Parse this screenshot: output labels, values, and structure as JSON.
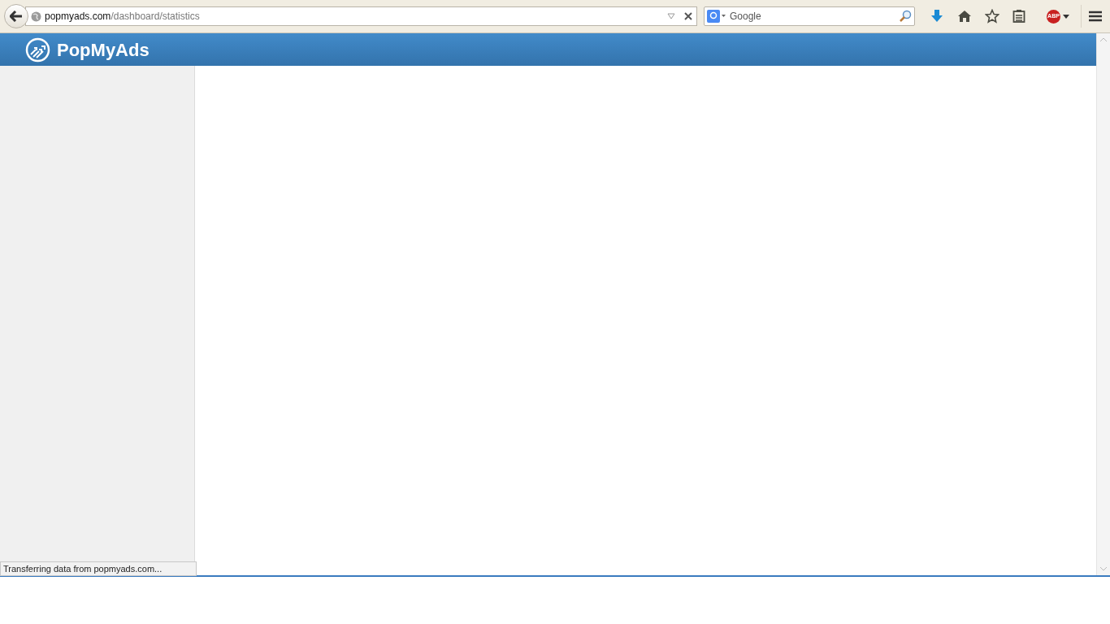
{
  "browser": {
    "url_host": "popmyads.com",
    "url_path": "/dashboard/statistics",
    "search_placeholder": "Google",
    "addon_badge": "ABP"
  },
  "header": {
    "brand": "PopMyAds"
  },
  "status_bar": {
    "text": "Transferring data from popmyads.com..."
  }
}
